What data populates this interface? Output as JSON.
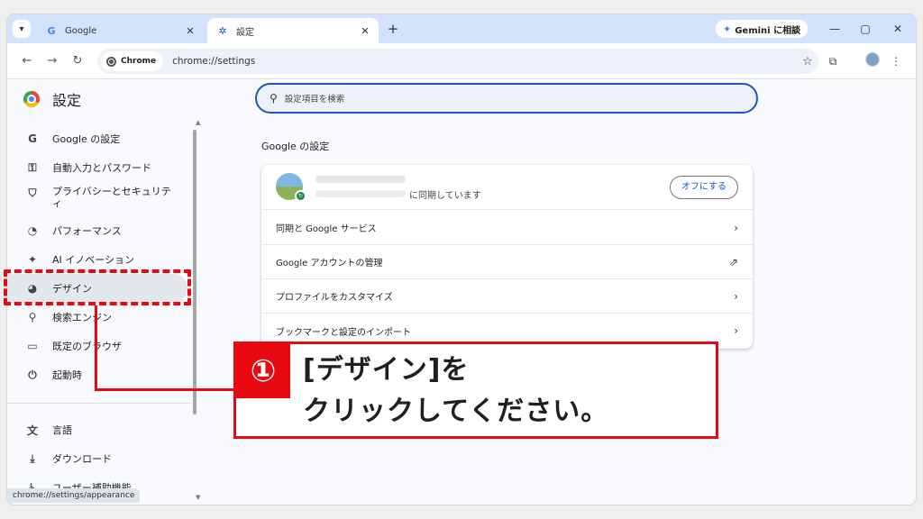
{
  "tabs": [
    {
      "title": "Google",
      "favicon": "G"
    },
    {
      "title": "設定",
      "favicon": "✲"
    }
  ],
  "gemini": {
    "label": "Gemini に相談"
  },
  "toolbar": {
    "chrome_chip": "Chrome",
    "url": "chrome://settings"
  },
  "app_title": "設定",
  "sidebar": {
    "items": [
      {
        "label": "Google の設定",
        "icon": "G"
      },
      {
        "label": "自動入力とパスワード",
        "icon": "⚿"
      },
      {
        "label": "プライバシーとセキュリティ",
        "icon": "⛉"
      },
      {
        "label": "パフォーマンス",
        "icon": "◔"
      },
      {
        "label": "AI イノベーション",
        "icon": "✦"
      },
      {
        "label": "デザイン",
        "icon": "◕"
      },
      {
        "label": "検索エンジン",
        "icon": "⚲"
      },
      {
        "label": "既定のブラウザ",
        "icon": "▭"
      },
      {
        "label": "起動時",
        "icon": "⏻"
      },
      {
        "label": "言語",
        "icon": "文"
      },
      {
        "label": "ダウンロード",
        "icon": "⤓"
      },
      {
        "label": "ユーザー補助機能",
        "icon": "♿"
      }
    ]
  },
  "status_url": "chrome://settings/appearance",
  "search": {
    "placeholder": "設定項目を検索"
  },
  "section_title": "Google の設定",
  "card": {
    "sync_text": "に同期しています",
    "off_button": "オフにする",
    "rows": [
      {
        "label": "同期と Google サービス",
        "icon": "›"
      },
      {
        "label": "Google アカウントの管理",
        "icon": "⇗"
      },
      {
        "label": "プロファイルをカスタマイズ",
        "icon": "›"
      },
      {
        "label": "ブックマークと設定のインポート",
        "icon": "›"
      }
    ]
  },
  "callout": {
    "number": "①",
    "line1": "[デザイン]を",
    "line2": "クリックしてください。"
  },
  "colors": {
    "accent": "#e8080f",
    "tabstrip": "#d3e3fd",
    "link": "#0b57d0"
  }
}
